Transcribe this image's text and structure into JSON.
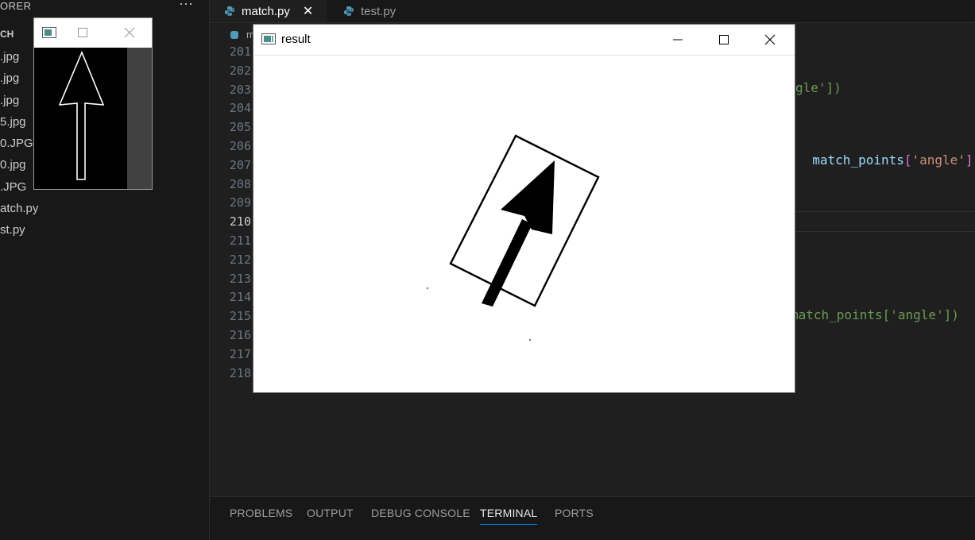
{
  "explorer": {
    "title": "ORER",
    "more": "···",
    "section": "CH",
    "files": [
      ".jpg",
      ".jpg",
      ".jpg",
      "5.jpg",
      "0.JPG",
      "0.jpg",
      ".JPG",
      "atch.py",
      "st.py"
    ]
  },
  "tabs": [
    {
      "label": "match.py",
      "active": true,
      "close": "✕"
    },
    {
      "label": "test.py",
      "active": false
    }
  ],
  "breadcrumb": "m",
  "editor": {
    "line_numbers": [
      "201",
      "202",
      "203",
      "204",
      "205",
      "206",
      "207",
      "208",
      "209",
      "210",
      "211",
      "212",
      "213",
      "214",
      "215",
      "216",
      "217",
      "218"
    ],
    "current_line": "210",
    "code_fragments": {
      "line203_tail": "gle'])",
      "line206_tail_ident": "match_points",
      "line206_tail_bracket_open": "[",
      "line206_tail_string": "'angle'",
      "line206_tail_bracket_close": "])",
      "line215_tail": "match_points['angle'])"
    }
  },
  "panel": {
    "tabs": [
      "PROBLEMS",
      "OUTPUT",
      "DEBUG CONSOLE",
      "TERMINAL",
      "PORTS"
    ],
    "active_tab": "TERMINAL"
  },
  "result_window": {
    "title": "result"
  },
  "colors": {
    "editor_bg": "#1f1f1f",
    "sidebar_bg": "#181818",
    "accent": "#0078d4",
    "python_icon": "#519aba",
    "identifier": "#9cdcfe",
    "string": "#ce9178",
    "bracket": "#da70d6",
    "comment_green": "#6a9955"
  }
}
